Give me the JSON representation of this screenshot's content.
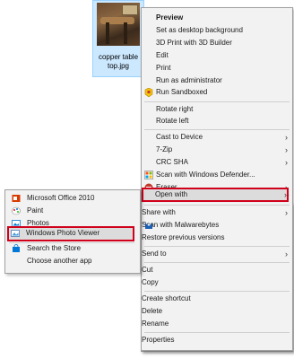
{
  "file": {
    "name_line1": "copper table",
    "name_line2": "top.jpg"
  },
  "context_menu": {
    "preview": "Preview",
    "set_desktop_background": "Set as desktop background",
    "print_3d": "3D Print with 3D Builder",
    "edit": "Edit",
    "print": "Print",
    "run_as_admin": "Run as administrator",
    "run_sandboxed": "Run Sandboxed",
    "rotate_right": "Rotate right",
    "rotate_left": "Rotate left",
    "cast_to_device": "Cast to Device",
    "seven_zip": "7-Zip",
    "crc_sha": "CRC SHA",
    "scan_defender": "Scan with Windows Defender...",
    "eraser": "Eraser",
    "open_with": "Open with",
    "share_with": "Share with",
    "scan_malwarebytes": "Scan with Malwarebytes",
    "restore_versions": "Restore previous versions",
    "send_to": "Send to",
    "cut": "Cut",
    "copy": "Copy",
    "create_shortcut": "Create shortcut",
    "delete": "Delete",
    "rename": "Rename",
    "properties": "Properties"
  },
  "open_with_menu": {
    "office": "Microsoft Office 2010",
    "paint": "Paint",
    "photos": "Photos",
    "photo_viewer": "Windows Photo Viewer",
    "search_store": "Search the Store",
    "choose_app": "Choose another app"
  },
  "icons": {
    "submenu_arrow": "›",
    "sandboxie": "sandboxie-icon",
    "defender": "windows-defender-icon",
    "eraser": "eraser-icon",
    "malwarebytes": "malwarebytes-icon",
    "office": "office-icon",
    "paint": "paint-icon",
    "photos": "photos-icon",
    "photo_viewer": "photo-viewer-icon",
    "store": "store-icon"
  },
  "colors": {
    "highlight_border": "#d0021b",
    "menu_bg": "#f2f2f2",
    "selection_bg": "#cce8ff"
  }
}
